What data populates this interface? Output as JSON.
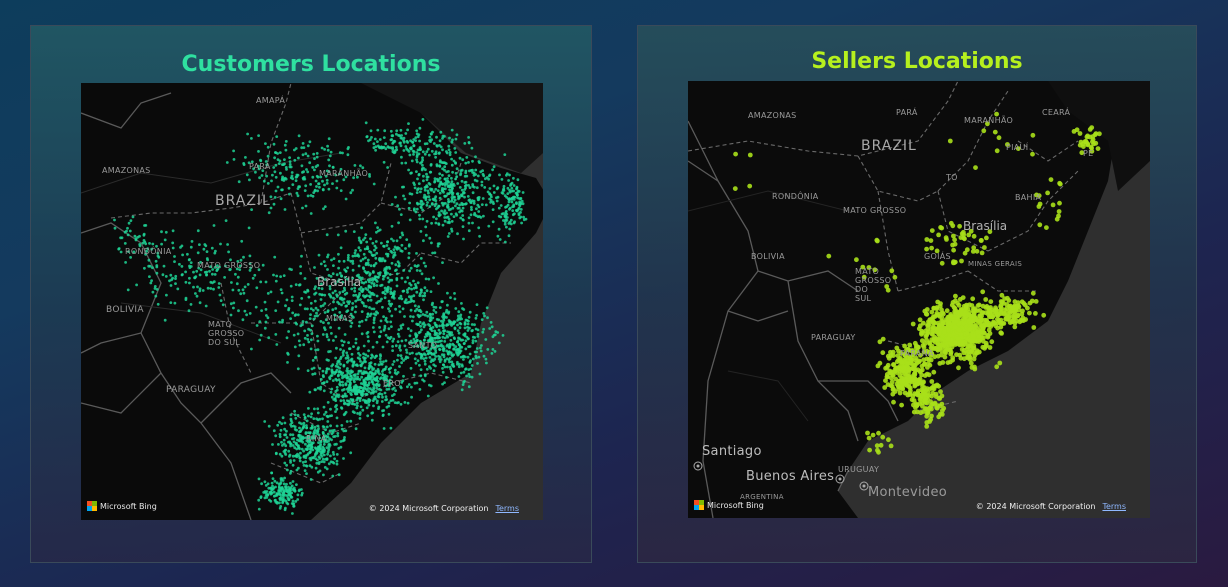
{
  "customers": {
    "title": "Customers Locations",
    "title_color": "#2fe0a0",
    "dot_color": "#1fd495",
    "labels": {
      "amapa": "AMAPÁ",
      "amazonas": "AMAZONAS",
      "para": "PARÁ",
      "maranhao": "MARANHÃO",
      "brazil": "BRAZIL",
      "rondonia": "RONDÔNIA",
      "mato_grosso": "MATO GROSSO",
      "bolivia": "BOLIVIA",
      "brasilia": "Brasília",
      "mato_grosso_do_sul": "MATO GROSSO DO SUL",
      "minas": "MINAS",
      "santo": "SANTO",
      "paraguay": "PARAGUAY",
      "janeiro": "ERO",
      "catarina": "RINA"
    },
    "attribution": {
      "bing": "Microsoft Bing",
      "copyright": "© 2024 Microsoft Corporation",
      "terms": "Terms"
    }
  },
  "sellers": {
    "title": "Sellers Locations",
    "title_color": "#b6f01e",
    "dot_color": "#a8e01a",
    "labels": {
      "amazonas": "AMAZONAS",
      "para": "PARÁ",
      "maranhao": "MARANHÃO",
      "ceara": "CEARÁ",
      "brazil": "BRAZIL",
      "piaui": "PIAUÍ",
      "rondonia": "RONDÔNIA",
      "to": "TO",
      "mato_grosso": "MATO GROSSO",
      "bahia": "BAHIA",
      "brasilia": "Brasília",
      "bolivia": "BOLIVIA",
      "goias": "GOIÁS",
      "minas_gerais": "MINAS GERAIS",
      "mato_grosso_do_sul": "MATO GROSSO DO SUL",
      "paraguay": "PARAGUAY",
      "parana": "PARANÁ",
      "santiago": "Santiago",
      "buenos_aires": "Buenos Aires",
      "uruguay": "URUGUAY",
      "montevideo": "Montevideo",
      "argentina": "ARGENTINA",
      "pe": "PE"
    },
    "attribution": {
      "bing": "Microsoft Bing",
      "copyright": "© 2024 Microsoft Corporation",
      "terms": "Terms"
    }
  }
}
